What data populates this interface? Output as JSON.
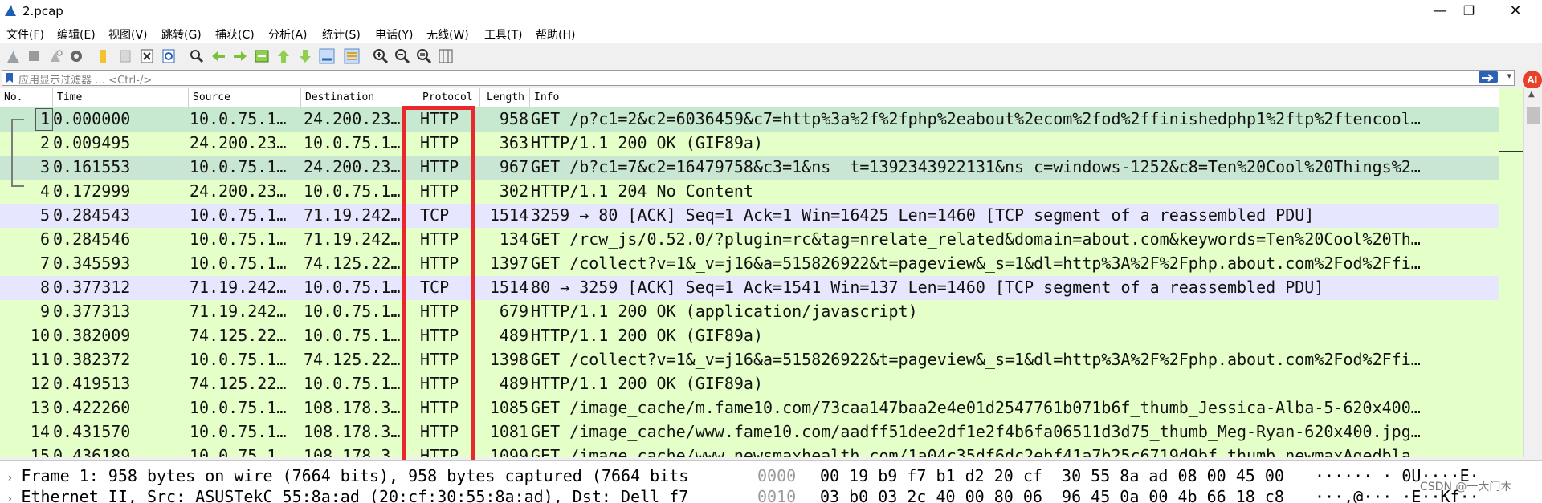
{
  "window": {
    "title": "2.pcap",
    "minimize": "—",
    "maximize": "❐",
    "close": "✕"
  },
  "menu": [
    "文件(F)",
    "编辑(E)",
    "视图(V)",
    "跳转(G)",
    "捕获(C)",
    "分析(A)",
    "统计(S)",
    "电话(Y)",
    "无线(W)",
    "工具(T)",
    "帮助(H)"
  ],
  "toolbar_icons": [
    "shark-fin-start-icon",
    "stop-icon",
    "restart-icon",
    "options-gear-icon",
    "open-file-icon",
    "save-file-icon",
    "close-file-icon",
    "reload-icon",
    "find-icon",
    "go-back-icon",
    "go-forward-icon",
    "go-to-packet-icon",
    "first-packet-icon",
    "last-packet-icon",
    "autoscroll-icon",
    "colorize-icon",
    "zoom-in-icon",
    "zoom-out-icon",
    "zoom-normal-icon",
    "resize-columns-icon"
  ],
  "filter": {
    "placeholder": "应用显示过滤器 … <Ctrl-/>"
  },
  "columns": {
    "no": "No.",
    "time": "Time",
    "source": "Source",
    "destination": "Destination",
    "protocol": "Protocol",
    "length": "Length",
    "info": "Info"
  },
  "packets": [
    {
      "no": "1",
      "time": "0.000000",
      "src": "10.0.75.1…",
      "dst": "24.200.23…",
      "proto": "HTTP",
      "len": "958",
      "info": "GET /p?c1=2&c2=6036459&c7=http%3a%2f%2fphp%2eabout%2ecom%2fod%2ffinishedphp1%2ftp%2ftencool…"
    },
    {
      "no": "2",
      "time": "0.009495",
      "src": "24.200.23…",
      "dst": "10.0.75.1…",
      "proto": "HTTP",
      "len": "363",
      "info": "HTTP/1.1 200 OK  (GIF89a)"
    },
    {
      "no": "3",
      "time": "0.161553",
      "src": "10.0.75.1…",
      "dst": "24.200.23…",
      "proto": "HTTP",
      "len": "967",
      "info": "GET /b?c1=7&c2=16479758&c3=1&ns__t=1392343922131&ns_c=windows-1252&c8=Ten%20Cool%20Things%2…"
    },
    {
      "no": "4",
      "time": "0.172999",
      "src": "24.200.23…",
      "dst": "10.0.75.1…",
      "proto": "HTTP",
      "len": "302",
      "info": "HTTP/1.1 204 No Content"
    },
    {
      "no": "5",
      "time": "0.284543",
      "src": "10.0.75.1…",
      "dst": "71.19.242…",
      "proto": "TCP",
      "len": "1514",
      "info": "3259 → 80 [ACK] Seq=1 Ack=1 Win=16425 Len=1460 [TCP segment of a reassembled PDU]"
    },
    {
      "no": "6",
      "time": "0.284546",
      "src": "10.0.75.1…",
      "dst": "71.19.242…",
      "proto": "HTTP",
      "len": "134",
      "info": "GET /rcw_js/0.52.0/?plugin=rc&tag=nrelate_related&domain=about.com&keywords=Ten%20Cool%20Th…"
    },
    {
      "no": "7",
      "time": "0.345593",
      "src": "10.0.75.1…",
      "dst": "74.125.22…",
      "proto": "HTTP",
      "len": "1397",
      "info": "GET /collect?v=1&_v=j16&a=515826922&t=pageview&_s=1&dl=http%3A%2F%2Fphp.about.com%2Fod%2Ffi…"
    },
    {
      "no": "8",
      "time": "0.377312",
      "src": "71.19.242…",
      "dst": "10.0.75.1…",
      "proto": "TCP",
      "len": "1514",
      "info": "80 → 3259 [ACK] Seq=1 Ack=1541 Win=137 Len=1460 [TCP segment of a reassembled PDU]"
    },
    {
      "no": "9",
      "time": "0.377313",
      "src": "71.19.242…",
      "dst": "10.0.75.1…",
      "proto": "HTTP",
      "len": "679",
      "info": "HTTP/1.1 200 OK  (application/javascript)"
    },
    {
      "no": "10",
      "time": "0.382009",
      "src": "74.125.22…",
      "dst": "10.0.75.1…",
      "proto": "HTTP",
      "len": "489",
      "info": "HTTP/1.1 200 OK  (GIF89a)"
    },
    {
      "no": "11",
      "time": "0.382372",
      "src": "10.0.75.1…",
      "dst": "74.125.22…",
      "proto": "HTTP",
      "len": "1398",
      "info": "GET /collect?v=1&_v=j16&a=515826922&t=pageview&_s=1&dl=http%3A%2F%2Fphp.about.com%2Fod%2Ffi…"
    },
    {
      "no": "12",
      "time": "0.419513",
      "src": "74.125.22…",
      "dst": "10.0.75.1…",
      "proto": "HTTP",
      "len": "489",
      "info": "HTTP/1.1 200 OK  (GIF89a)"
    },
    {
      "no": "13",
      "time": "0.422260",
      "src": "10.0.75.1…",
      "dst": "108.178.3…",
      "proto": "HTTP",
      "len": "1085",
      "info": "GET /image_cache/m.fame10.com/73caa147baa2e4e01d2547761b071b6f_thumb_Jessica-Alba-5-620x400…"
    },
    {
      "no": "14",
      "time": "0.431570",
      "src": "10.0.75.1…",
      "dst": "108.178.3…",
      "proto": "HTTP",
      "len": "1081",
      "info": "GET /image_cache/www.fame10.com/aadff51dee2df1e2f4b6fa06511d3d75_thumb_Meg-Ryan-620x400.jpg…"
    },
    {
      "no": "15",
      "time": "0.436189",
      "src": "10.0.75.1…",
      "dst": "108.178.3…",
      "proto": "HTTP",
      "len": "1099",
      "info": "GET /image_cache/www.newsmaxhealth.com/1a04c35df6dc2ebf41a7b25c6719d9bf_thumb_newmaxAgedbla…"
    }
  ],
  "details": [
    "Frame 1: 958 bytes on wire (7664 bits), 958 bytes captured (7664 bits",
    "Ethernet II, Src: ASUSTekC_55:8a:ad (20:cf:30:55:8a:ad), Dst: Dell_f7"
  ],
  "hex": [
    {
      "offset": "0000",
      "bytes": "00 19 b9 f7 b1 d2 20 cf  30 55 8a ad 08 00 45 00",
      "ascii": "······ · 0U····E·"
    },
    {
      "offset": "0010",
      "bytes": "03 b0 03 2c 40 00 80 06  96 45 0a 00 4b 66 18 c8",
      "ascii": "···,@··· ·E··Kf··"
    }
  ],
  "watermark": "CSDN @一大门木",
  "ai_badge": "AI"
}
